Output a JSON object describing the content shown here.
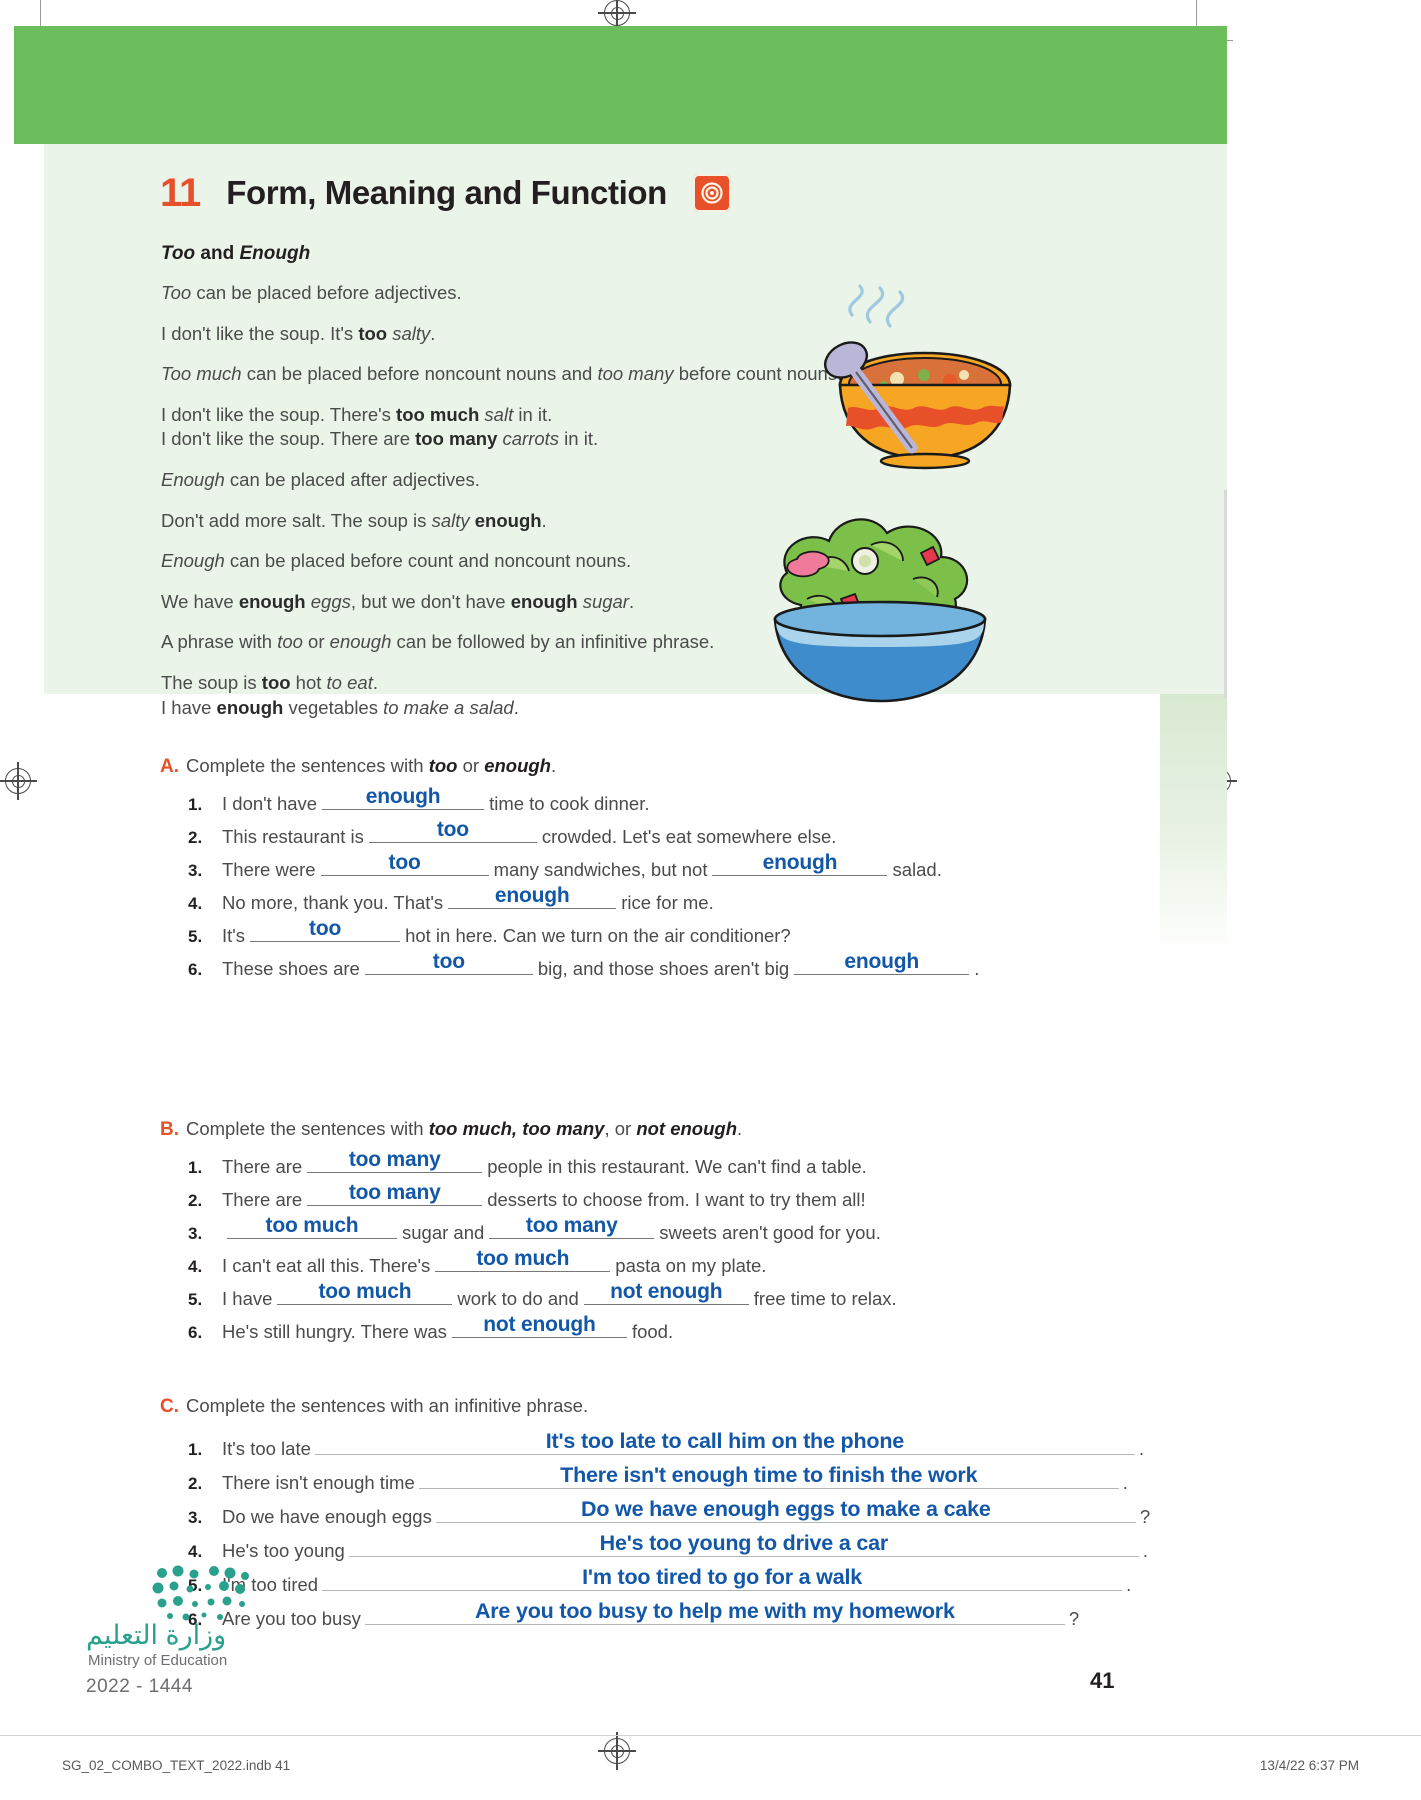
{
  "unit": {
    "number": "11",
    "title": "Form, Meaning and Function",
    "icon": "spiral-target-icon"
  },
  "grammar": {
    "subtitle_a": "Too",
    "subtitle_and": " and ",
    "subtitle_b": "Enough",
    "rules": [
      {
        "id": "r1",
        "parts": [
          {
            "t": "Too",
            "s": "i"
          },
          {
            "t": " can be placed before adjectives.",
            "s": ""
          }
        ]
      },
      {
        "id": "e1",
        "parts": [
          {
            "t": "I don't like the soup. It's ",
            "s": ""
          },
          {
            "t": "too",
            "s": "b"
          },
          {
            "t": " ",
            "s": ""
          },
          {
            "t": "salty",
            "s": "i"
          },
          {
            "t": ".",
            "s": ""
          }
        ]
      },
      {
        "id": "r2",
        "parts": [
          {
            "t": "Too much",
            "s": "i"
          },
          {
            "t": " can be placed before noncount nouns and ",
            "s": ""
          },
          {
            "t": "too many",
            "s": "i"
          },
          {
            "t": " before count nouns.",
            "s": ""
          }
        ]
      },
      {
        "id": "e2a",
        "parts": [
          {
            "t": "I don't like the soup. There's ",
            "s": ""
          },
          {
            "t": "too much",
            "s": "b"
          },
          {
            "t": " ",
            "s": ""
          },
          {
            "t": "salt",
            "s": "i"
          },
          {
            "t": " in it.",
            "s": ""
          }
        ]
      },
      {
        "id": "e2b",
        "parts": [
          {
            "t": "I don't like the soup. There are ",
            "s": ""
          },
          {
            "t": "too many",
            "s": "b"
          },
          {
            "t": " ",
            "s": ""
          },
          {
            "t": "carrots",
            "s": "i"
          },
          {
            "t": " in it.",
            "s": ""
          }
        ]
      },
      {
        "id": "r3",
        "parts": [
          {
            "t": "Enough",
            "s": "i"
          },
          {
            "t": " can be placed after adjectives.",
            "s": ""
          }
        ]
      },
      {
        "id": "e3",
        "parts": [
          {
            "t": "Don't add more salt. The soup is ",
            "s": ""
          },
          {
            "t": "salty",
            "s": "i"
          },
          {
            "t": " ",
            "s": ""
          },
          {
            "t": "enough",
            "s": "b"
          },
          {
            "t": ".",
            "s": ""
          }
        ]
      },
      {
        "id": "r4",
        "parts": [
          {
            "t": "Enough",
            "s": "i"
          },
          {
            "t": " can be placed before count and noncount nouns.",
            "s": ""
          }
        ]
      },
      {
        "id": "e4",
        "parts": [
          {
            "t": "We have ",
            "s": ""
          },
          {
            "t": "enough",
            "s": "b"
          },
          {
            "t": " ",
            "s": ""
          },
          {
            "t": "eggs",
            "s": "i"
          },
          {
            "t": ", but we don't have ",
            "s": ""
          },
          {
            "t": "enough",
            "s": "b"
          },
          {
            "t": " ",
            "s": ""
          },
          {
            "t": "sugar",
            "s": "i"
          },
          {
            "t": ".",
            "s": ""
          }
        ]
      },
      {
        "id": "r5",
        "parts": [
          {
            "t": "A phrase with ",
            "s": ""
          },
          {
            "t": "too",
            "s": "i"
          },
          {
            "t": " or ",
            "s": ""
          },
          {
            "t": "enough",
            "s": "i"
          },
          {
            "t": " can be followed by an infinitive phrase.",
            "s": ""
          }
        ]
      },
      {
        "id": "e5a",
        "parts": [
          {
            "t": "The soup is ",
            "s": ""
          },
          {
            "t": "too",
            "s": "b"
          },
          {
            "t": " hot ",
            "s": ""
          },
          {
            "t": "to eat",
            "s": "i"
          },
          {
            "t": ".",
            "s": ""
          }
        ]
      },
      {
        "id": "e5b",
        "parts": [
          {
            "t": "I have ",
            "s": ""
          },
          {
            "t": "enough",
            "s": "b"
          },
          {
            "t": " vegetables ",
            "s": ""
          },
          {
            "t": "to make a salad",
            "s": "i"
          },
          {
            "t": ".",
            "s": ""
          }
        ]
      }
    ]
  },
  "exercises": [
    {
      "letter": "A.",
      "instruction_pre": "Complete the sentences with ",
      "instruction_bold1": "too",
      "instruction_mid": " or ",
      "instruction_bold2": "enough",
      "instruction_end": ".",
      "items": [
        {
          "n": "1.",
          "pre": "I don't have",
          "answer": "enough",
          "post": "time to cook dinner.",
          "answer2": "",
          "post2": ""
        },
        {
          "n": "2.",
          "pre": "This restaurant is",
          "answer": "too",
          "post": "crowded. Let's eat somewhere else.",
          "answer2": "",
          "post2": ""
        },
        {
          "n": "3.",
          "pre": "There were",
          "answer": "too",
          "post": "many sandwiches, but not",
          "answer2": "enough",
          "post2": "salad."
        },
        {
          "n": "4.",
          "pre": "No more, thank you. That's",
          "answer": "enough",
          "post": "rice for me.",
          "answer2": "",
          "post2": ""
        },
        {
          "n": "5.",
          "pre": "It's",
          "answer": "too",
          "post": "hot in here. Can we turn on the air conditioner?",
          "answer2": "",
          "post2": ""
        },
        {
          "n": "6.",
          "pre": "These shoes are",
          "answer": "too",
          "post": "big, and those shoes aren't big",
          "answer2": "enough",
          "post2": "."
        }
      ]
    },
    {
      "letter": "B.",
      "instruction_pre": "Complete the sentences with ",
      "instruction_bold1": "too much, too many",
      "instruction_mid": ", or ",
      "instruction_bold2": "not enough",
      "instruction_end": ".",
      "items": [
        {
          "n": "1.",
          "pre": "There are",
          "answer": "too many",
          "post": "people in this restaurant. We can't find a table.",
          "answer2": "",
          "post2": ""
        },
        {
          "n": "2.",
          "pre": "There are",
          "answer": "too many",
          "post": "desserts to choose from. I want to try them all!",
          "answer2": "",
          "post2": ""
        },
        {
          "n": "3.",
          "pre": "",
          "answer": "too much",
          "post": "sugar and",
          "answer2": "too many",
          "post2": "sweets aren't good for you."
        },
        {
          "n": "4.",
          "pre": "I can't eat all this. There's",
          "answer": "too much",
          "post": "pasta on my plate.",
          "answer2": "",
          "post2": ""
        },
        {
          "n": "5.",
          "pre": "I have",
          "answer": "too much",
          "post": "work to do and",
          "answer2": "not enough",
          "post2": "free time to relax."
        },
        {
          "n": "6.",
          "pre": "He's still hungry. There was",
          "answer": "not enough",
          "post": "food.",
          "answer2": "",
          "post2": ""
        }
      ]
    },
    {
      "letter": "C.",
      "instruction_pre": "Complete the sentences with an infinitive phrase.",
      "instruction_bold1": "",
      "instruction_mid": "",
      "instruction_bold2": "",
      "instruction_end": "",
      "items": [
        {
          "n": "1.",
          "pre": "It's too late",
          "answer": "It's too late to call him on the phone",
          "post": ".",
          "answer2": "",
          "post2": ""
        },
        {
          "n": "2.",
          "pre": "There isn't enough time",
          "answer": "There isn't enough time to finish the work",
          "post": ".",
          "answer2": "",
          "post2": ""
        },
        {
          "n": "3.",
          "pre": "Do we have enough eggs",
          "answer": "Do we have enough eggs to make a cake",
          "post": "?",
          "answer2": "",
          "post2": ""
        },
        {
          "n": "4.",
          "pre": "He's too young",
          "answer": "He's too young to drive a car",
          "post": ".",
          "answer2": "",
          "post2": ""
        },
        {
          "n": "5.",
          "pre": "I'm too tired",
          "answer": "I'm too tired to go for a walk",
          "post": ".",
          "answer2": "",
          "post2": ""
        },
        {
          "n": "6.",
          "pre": "Are you too busy",
          "answer": "Are you too busy to help me with my homework",
          "post": "?",
          "answer2": "",
          "post2": ""
        }
      ]
    }
  ],
  "footer": {
    "ministry_ar": "وزارة التعليم",
    "ministry_en": "Ministry of Education",
    "year": "2022 - 1444",
    "page_number": "41",
    "print_file": "SG_02_COMBO_TEXT_2022.indb   41",
    "print_date": "13/4/22   6:37 PM"
  },
  "colors": {
    "accent_orange": "#e8502a",
    "banner_green": "#6cbe5c",
    "panel_green": "#eaf4e9",
    "handwriting_blue": "#1257a8",
    "ministry_teal": "#2aa18c"
  }
}
